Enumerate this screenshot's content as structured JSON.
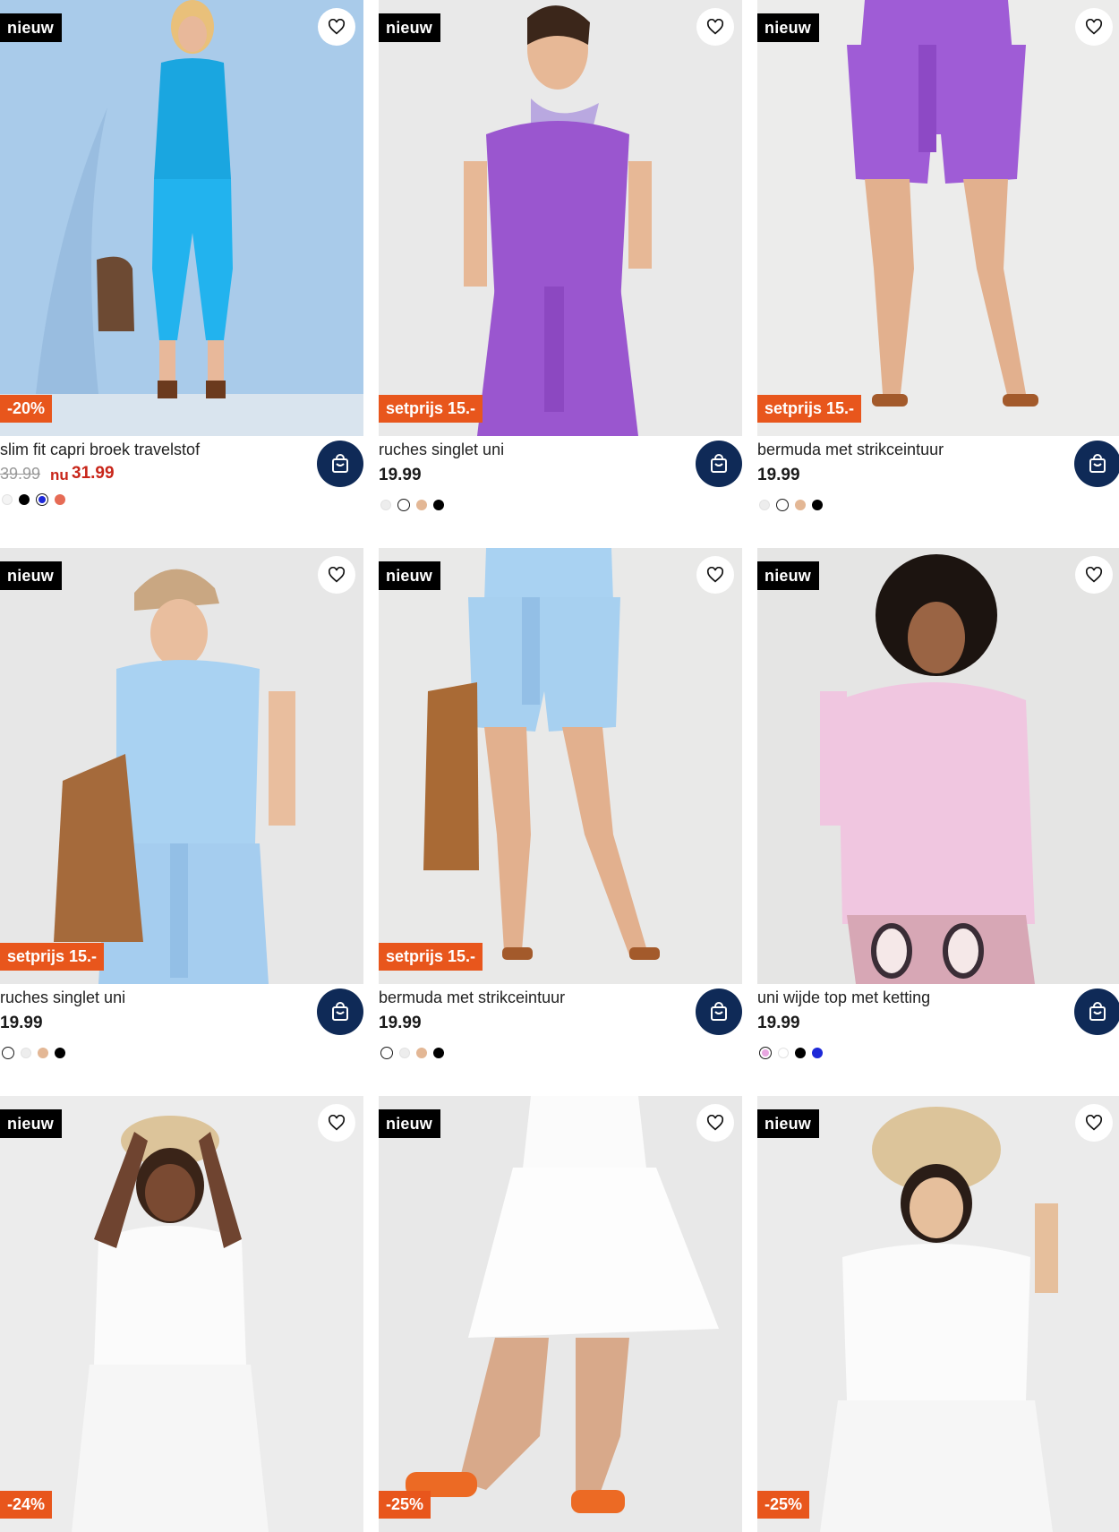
{
  "colors": {
    "accent_dark": "#0f2a57",
    "promo": "#e8561c",
    "sale_price": "#c8261a",
    "badge_new_bg": "#000000"
  },
  "products": [
    {
      "badge": "nieuw",
      "promo": "-20%",
      "title": "slim fit capri broek travelstof",
      "price_old": "39.99",
      "price_nu": "nu",
      "price_new": "31.99",
      "price": "",
      "swatches": [
        "#f4f4f4",
        "#000000",
        "#1d28d8",
        "#e66b55"
      ],
      "selected_swatch": 2,
      "photo_bg": "#a8cbe8",
      "cart_icon": "shopping-bag-icon",
      "fav_icon": "heart-icon"
    },
    {
      "badge": "nieuw",
      "promo": "setprijs 15.-",
      "title": "ruches singlet uni",
      "price": "19.99",
      "swatches": [
        "#ededed",
        "#ffffff",
        "#e3b795",
        "#000000"
      ],
      "selected_swatch": 1,
      "photo_bg": "#e9e9e9",
      "cart_icon": "shopping-bag-icon",
      "fav_icon": "heart-icon"
    },
    {
      "badge": "nieuw",
      "promo": "setprijs 15.-",
      "title": "bermuda met strikceintuur",
      "price": "19.99",
      "swatches": [
        "#ededed",
        "#ffffff",
        "#e3b795",
        "#000000"
      ],
      "selected_swatch": 1,
      "photo_bg": "#ececeb",
      "cart_icon": "shopping-bag-icon",
      "fav_icon": "heart-icon"
    },
    {
      "badge": "nieuw",
      "promo": "setprijs 15.-",
      "title": "ruches singlet uni",
      "price": "19.99",
      "swatches": [
        "#ffffff",
        "#ededed",
        "#e3b795",
        "#000000"
      ],
      "selected_swatch": 0,
      "photo_bg": "#e7e7e7",
      "cart_icon": "shopping-bag-icon",
      "fav_icon": "heart-icon"
    },
    {
      "badge": "nieuw",
      "promo": "setprijs 15.-",
      "title": "bermuda met strikceintuur",
      "price": "19.99",
      "swatches": [
        "#ffffff",
        "#ededed",
        "#e3b795",
        "#000000"
      ],
      "selected_swatch": 0,
      "photo_bg": "#e9e9e8",
      "cart_icon": "shopping-bag-icon",
      "fav_icon": "heart-icon"
    },
    {
      "badge": "nieuw",
      "promo": "",
      "title": "uni wijde top met ketting",
      "price": "19.99",
      "swatches": [
        "#e8a6e0",
        "#ffffff",
        "#000000",
        "#1d28d8"
      ],
      "selected_swatch": 0,
      "photo_bg": "#e5e5e4",
      "cart_icon": "shopping-bag-icon",
      "fav_icon": "heart-icon"
    },
    {
      "badge": "nieuw",
      "promo": "-24%",
      "title": "",
      "price": "",
      "swatches": [],
      "photo_bg": "#ececec",
      "fav_icon": "heart-icon"
    },
    {
      "badge": "nieuw",
      "promo": "-25%",
      "title": "",
      "price": "",
      "swatches": [],
      "photo_bg": "#e8e8e8",
      "fav_icon": "heart-icon"
    },
    {
      "badge": "nieuw",
      "promo": "-25%",
      "title": "",
      "price": "",
      "swatches": [],
      "photo_bg": "#ebebeb",
      "fav_icon": "heart-icon"
    }
  ]
}
